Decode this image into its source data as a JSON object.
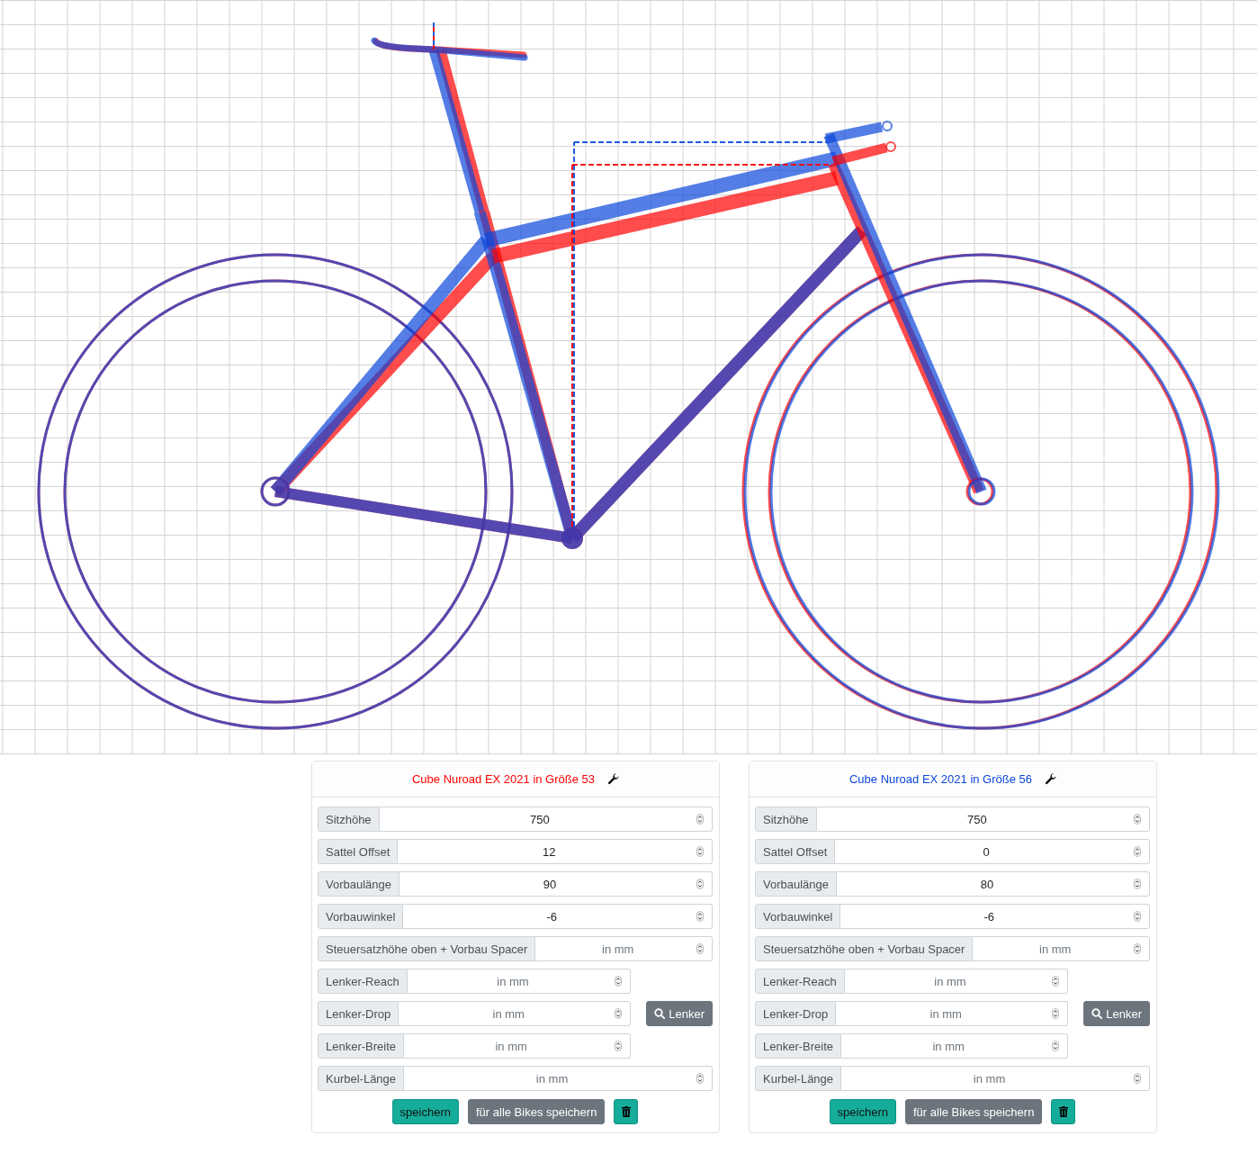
{
  "bikes": [
    {
      "title": "Cube Nuroad EX 2021 in Größe 53",
      "color": "#ff0000",
      "fields": [
        {
          "label": "Sitzhöhe",
          "value": "750",
          "kind": "wide"
        },
        {
          "label": "Sattel Offset",
          "value": "12",
          "kind": "wide"
        },
        {
          "label": "Vorbaulänge",
          "value": "90",
          "kind": "wide"
        },
        {
          "label": "Vorbauwinkel",
          "value": "-6",
          "kind": "wide"
        },
        {
          "label": "Steuersatzhöhe oben + Vorbau Spacer",
          "placeholder": "in mm",
          "kind": "wide"
        },
        {
          "label": "Lenker-Reach",
          "placeholder": "in mm",
          "kind": "narrow"
        },
        {
          "label": "Lenker-Drop",
          "placeholder": "in mm",
          "kind": "narrow"
        },
        {
          "label": "Lenker-Breite",
          "placeholder": "in mm",
          "kind": "narrow"
        },
        {
          "label": "Kurbel-Länge",
          "placeholder": "in mm",
          "kind": "wide"
        }
      ],
      "handlebar_button": "Lenker",
      "actions": [
        {
          "kind": "primary",
          "label": "speichern"
        },
        {
          "kind": "secondary",
          "label": "für alle Bikes speichern"
        },
        {
          "kind": "delete"
        }
      ]
    },
    {
      "title": "Cube Nuroad EX 2021 in Größe 56",
      "color": "#0b47db",
      "fields": [
        {
          "label": "Sitzhöhe",
          "value": "750",
          "kind": "wide"
        },
        {
          "label": "Sattel Offset",
          "value": "0",
          "kind": "wide"
        },
        {
          "label": "Vorbaulänge",
          "value": "80",
          "kind": "wide"
        },
        {
          "label": "Vorbauwinkel",
          "value": "-6",
          "kind": "wide"
        },
        {
          "label": "Steuersatzhöhe oben + Vorbau Spacer",
          "placeholder": "in mm",
          "kind": "wide"
        },
        {
          "label": "Lenker-Reach",
          "placeholder": "in mm",
          "kind": "narrow"
        },
        {
          "label": "Lenker-Drop",
          "placeholder": "in mm",
          "kind": "narrow"
        },
        {
          "label": "Lenker-Breite",
          "placeholder": "in mm",
          "kind": "narrow"
        },
        {
          "label": "Kurbel-Länge",
          "placeholder": "in mm",
          "kind": "wide"
        }
      ],
      "handlebar_button": "Lenker",
      "actions": [
        {
          "kind": "primary",
          "label": "speichern"
        },
        {
          "kind": "secondary",
          "label": "für alle Bikes speichern"
        },
        {
          "kind": "delete"
        }
      ]
    }
  ]
}
